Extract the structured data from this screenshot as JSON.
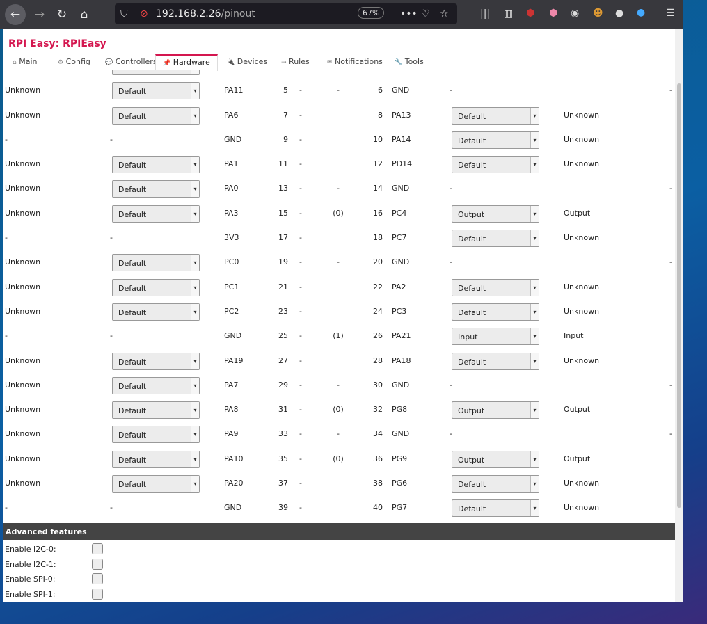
{
  "browser": {
    "url_host": "192.168.2.26",
    "url_path": "/pinout",
    "zoom": "67%"
  },
  "app": {
    "title": "RPI Easy: RPIEasy"
  },
  "tabs": [
    {
      "label": "Main",
      "icon": "⌂"
    },
    {
      "label": "Config",
      "icon": "⚙"
    },
    {
      "label": "Controllers",
      "icon": "💬"
    },
    {
      "label": "Hardware",
      "icon": "📌",
      "active": true
    },
    {
      "label": "Devices",
      "icon": "🔌"
    },
    {
      "label": "Rules",
      "icon": "→"
    },
    {
      "label": "Notifications",
      "icon": "✉"
    },
    {
      "label": "Tools",
      "icon": "🔧"
    }
  ],
  "pins": [
    {
      "ls": "Unknown",
      "lm": "Default",
      "ln": "PA11",
      "lp": "5",
      "d1": "-",
      "d2": "-",
      "rp": "6",
      "rn": "GND",
      "rm": "-",
      "rs": "-"
    },
    {
      "ls": "Unknown",
      "lm": "Default",
      "ln": "PA6",
      "lp": "7",
      "d1": "-",
      "d2": "",
      "rp": "8",
      "rn": "PA13",
      "rm": "Default",
      "rs": "Unknown"
    },
    {
      "ls": "-",
      "lm": "-",
      "ln": "GND",
      "lp": "9",
      "d1": "-",
      "d2": "",
      "rp": "10",
      "rn": "PA14",
      "rm": "Default",
      "rs": "Unknown"
    },
    {
      "ls": "Unknown",
      "lm": "Default",
      "ln": "PA1",
      "lp": "11",
      "d1": "-",
      "d2": "",
      "rp": "12",
      "rn": "PD14",
      "rm": "Default",
      "rs": "Unknown"
    },
    {
      "ls": "Unknown",
      "lm": "Default",
      "ln": "PA0",
      "lp": "13",
      "d1": "-",
      "d2": "-",
      "rp": "14",
      "rn": "GND",
      "rm": "-",
      "rs": "-"
    },
    {
      "ls": "Unknown",
      "lm": "Default",
      "ln": "PA3",
      "lp": "15",
      "d1": "-",
      "d2": "(0)",
      "rp": "16",
      "rn": "PC4",
      "rm": "Output",
      "rs": "Output"
    },
    {
      "ls": "-",
      "lm": "-",
      "ln": "3V3",
      "lp": "17",
      "d1": "-",
      "d2": "",
      "rp": "18",
      "rn": "PC7",
      "rm": "Default",
      "rs": "Unknown"
    },
    {
      "ls": "Unknown",
      "lm": "Default",
      "ln": "PC0",
      "lp": "19",
      "d1": "-",
      "d2": "-",
      "rp": "20",
      "rn": "GND",
      "rm": "-",
      "rs": "-"
    },
    {
      "ls": "Unknown",
      "lm": "Default",
      "ln": "PC1",
      "lp": "21",
      "d1": "-",
      "d2": "",
      "rp": "22",
      "rn": "PA2",
      "rm": "Default",
      "rs": "Unknown"
    },
    {
      "ls": "Unknown",
      "lm": "Default",
      "ln": "PC2",
      "lp": "23",
      "d1": "-",
      "d2": "",
      "rp": "24",
      "rn": "PC3",
      "rm": "Default",
      "rs": "Unknown"
    },
    {
      "ls": "-",
      "lm": "-",
      "ln": "GND",
      "lp": "25",
      "d1": "-",
      "d2": "(1)",
      "rp": "26",
      "rn": "PA21",
      "rm": "Input",
      "rs": "Input"
    },
    {
      "ls": "Unknown",
      "lm": "Default",
      "ln": "PA19",
      "lp": "27",
      "d1": "-",
      "d2": "",
      "rp": "28",
      "rn": "PA18",
      "rm": "Default",
      "rs": "Unknown"
    },
    {
      "ls": "Unknown",
      "lm": "Default",
      "ln": "PA7",
      "lp": "29",
      "d1": "-",
      "d2": "-",
      "rp": "30",
      "rn": "GND",
      "rm": "-",
      "rs": "-"
    },
    {
      "ls": "Unknown",
      "lm": "Default",
      "ln": "PA8",
      "lp": "31",
      "d1": "-",
      "d2": "(0)",
      "rp": "32",
      "rn": "PG8",
      "rm": "Output",
      "rs": "Output"
    },
    {
      "ls": "Unknown",
      "lm": "Default",
      "ln": "PA9",
      "lp": "33",
      "d1": "-",
      "d2": "-",
      "rp": "34",
      "rn": "GND",
      "rm": "-",
      "rs": "-"
    },
    {
      "ls": "Unknown",
      "lm": "Default",
      "ln": "PA10",
      "lp": "35",
      "d1": "-",
      "d2": "(0)",
      "rp": "36",
      "rn": "PG9",
      "rm": "Output",
      "rs": "Output"
    },
    {
      "ls": "Unknown",
      "lm": "Default",
      "ln": "PA20",
      "lp": "37",
      "d1": "-",
      "d2": "",
      "rp": "38",
      "rn": "PG6",
      "rm": "Default",
      "rs": "Unknown"
    },
    {
      "ls": "-",
      "lm": "-",
      "ln": "GND",
      "lp": "39",
      "d1": "-",
      "d2": "",
      "rp": "40",
      "rn": "PG7",
      "rm": "Default",
      "rs": "Unknown"
    }
  ],
  "advanced": {
    "title": "Advanced features",
    "options": [
      {
        "label": "Enable I2C-0:",
        "checked": false
      },
      {
        "label": "Enable I2C-1:",
        "checked": false
      },
      {
        "label": "Enable SPI-0:",
        "checked": false
      },
      {
        "label": "Enable SPI-1:",
        "checked": false
      }
    ]
  },
  "colors": {
    "accent": "#d4164f",
    "section_bar": "#444444"
  }
}
